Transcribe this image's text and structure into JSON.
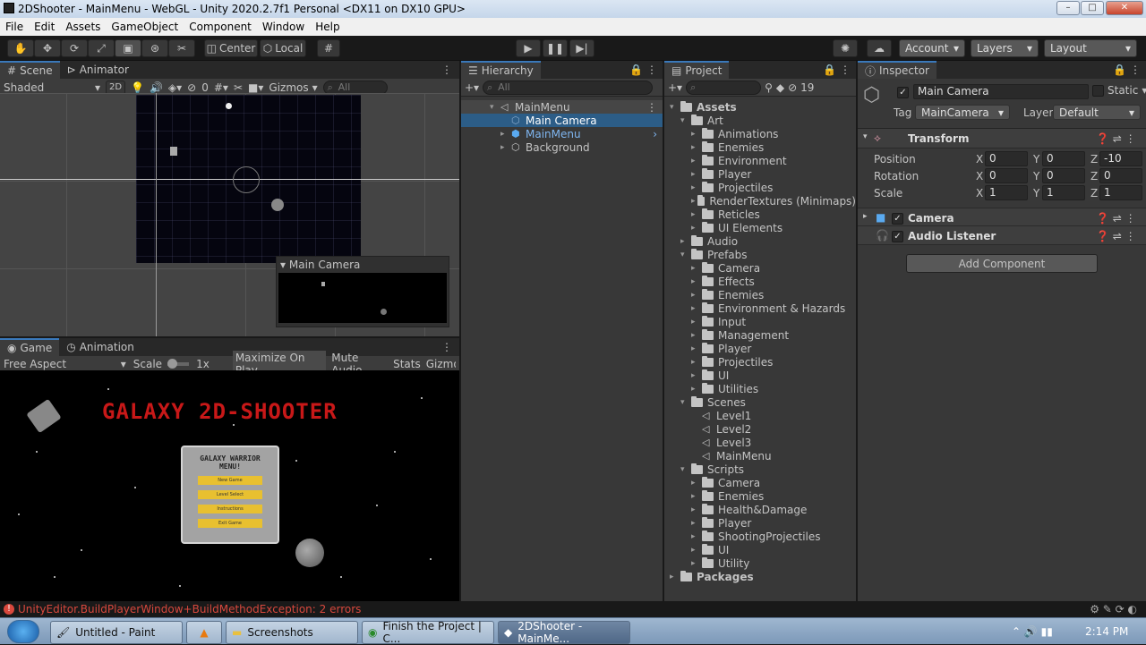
{
  "window": {
    "title": "2DShooter - MainMenu - WebGL - Unity 2020.2.7f1 Personal <DX11 on DX10 GPU>",
    "minimize": "–",
    "maximize": "□",
    "close": "✕"
  },
  "menu": [
    "File",
    "Edit",
    "Assets",
    "GameObject",
    "Component",
    "Window",
    "Help"
  ],
  "toolbar": {
    "center": "Center",
    "local": "Local",
    "account": "Account",
    "layers": "Layers",
    "layout": "Layout"
  },
  "scene": {
    "tab": "Scene",
    "tab2": "Animator",
    "shading": "Shaded",
    "mode2d": "2D",
    "hidden_count": "0",
    "gizmos": "Gizmos",
    "search_placeholder": "All",
    "camera_preview_title": "Main Camera"
  },
  "game": {
    "tab": "Game",
    "tab2": "Animation",
    "aspect": "Free Aspect",
    "scale_label": "Scale",
    "scale_value": "1x",
    "maximize": "Maximize On Play",
    "mute": "Mute Audio",
    "stats": "Stats",
    "gizmos": "Gizmos",
    "title": "GALAXY 2D-SHOOTER",
    "menu_title_1": "GALAXY WARRIOR",
    "menu_title_2": "MENU!",
    "buttons": [
      "New Game",
      "Level Select",
      "Instructions",
      "Exit Game"
    ]
  },
  "hierarchy": {
    "tab": "Hierarchy",
    "search_placeholder": "All",
    "items": [
      "MainMenu",
      "Main Camera",
      "MainMenu",
      "Background"
    ]
  },
  "project": {
    "tab": "Project",
    "count": "19",
    "rows": [
      {
        "d": 0,
        "t": "Assets",
        "o": true,
        "bold": true
      },
      {
        "d": 1,
        "t": "Art",
        "o": true
      },
      {
        "d": 2,
        "t": "Animations"
      },
      {
        "d": 2,
        "t": "Enemies"
      },
      {
        "d": 2,
        "t": "Environment"
      },
      {
        "d": 2,
        "t": "Player"
      },
      {
        "d": 2,
        "t": "Projectiles"
      },
      {
        "d": 2,
        "t": "RenderTextures (Minimaps)"
      },
      {
        "d": 2,
        "t": "Reticles"
      },
      {
        "d": 2,
        "t": "UI Elements"
      },
      {
        "d": 1,
        "t": "Audio"
      },
      {
        "d": 1,
        "t": "Prefabs",
        "o": true
      },
      {
        "d": 2,
        "t": "Camera"
      },
      {
        "d": 2,
        "t": "Effects"
      },
      {
        "d": 2,
        "t": "Enemies"
      },
      {
        "d": 2,
        "t": "Environment & Hazards"
      },
      {
        "d": 2,
        "t": "Input"
      },
      {
        "d": 2,
        "t": "Management"
      },
      {
        "d": 2,
        "t": "Player"
      },
      {
        "d": 2,
        "t": "Projectiles"
      },
      {
        "d": 2,
        "t": "UI"
      },
      {
        "d": 2,
        "t": "Utilities"
      },
      {
        "d": 1,
        "t": "Scenes",
        "o": true
      },
      {
        "d": 2,
        "t": "Level1",
        "s": true
      },
      {
        "d": 2,
        "t": "Level2",
        "s": true
      },
      {
        "d": 2,
        "t": "Level3",
        "s": true
      },
      {
        "d": 2,
        "t": "MainMenu",
        "s": true
      },
      {
        "d": 1,
        "t": "Scripts",
        "o": true
      },
      {
        "d": 2,
        "t": "Camera"
      },
      {
        "d": 2,
        "t": "Enemies"
      },
      {
        "d": 2,
        "t": "Health&Damage"
      },
      {
        "d": 2,
        "t": "Player"
      },
      {
        "d": 2,
        "t": "ShootingProjectiles"
      },
      {
        "d": 2,
        "t": "UI"
      },
      {
        "d": 2,
        "t": "Utility"
      },
      {
        "d": 0,
        "t": "Packages",
        "bold": true
      }
    ]
  },
  "inspector": {
    "tab": "Inspector",
    "object_name": "Main Camera",
    "static": "Static",
    "tag_label": "Tag",
    "tag_value": "MainCamera",
    "layer_label": "Layer",
    "layer_value": "Default",
    "transform": "Transform",
    "position_label": "Position",
    "rotation_label": "Rotation",
    "scale_label": "Scale",
    "position": {
      "x": "0",
      "y": "0",
      "z": "-10"
    },
    "rotation": {
      "x": "0",
      "y": "0",
      "z": "0"
    },
    "scale": {
      "x": "1",
      "y": "1",
      "z": "1"
    },
    "axis": {
      "x": "X",
      "y": "Y",
      "z": "Z"
    },
    "camera": "Camera",
    "audio_listener": "Audio Listener",
    "add_component": "Add Component"
  },
  "status": "UnityEditor.BuildPlayerWindow+BuildMethodException: 2 errors",
  "taskbar": {
    "items": [
      "Untitled - Paint",
      "Screenshots",
      "Finish the Project | C...",
      "2DShooter - MainMe..."
    ],
    "clock": "2:14 PM"
  },
  "colors": {
    "selection": "#2c5d87",
    "accent": "#3a79bb",
    "error": "#d8483d",
    "game_title": "#c81818"
  }
}
